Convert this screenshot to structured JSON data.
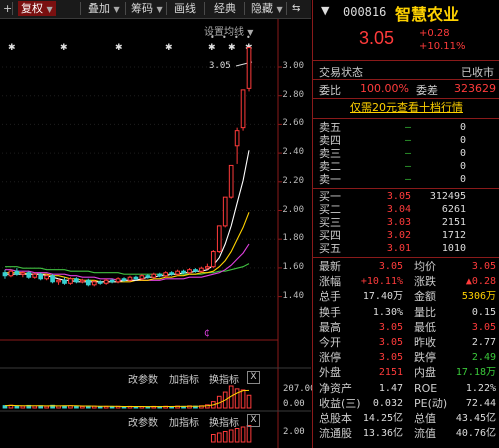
{
  "toolbar": {
    "items": [
      {
        "label": "复权",
        "active": true
      },
      {
        "label": "叠加",
        "active": false
      },
      {
        "label": "筹码",
        "active": false
      },
      {
        "label": "画线",
        "active": false
      },
      {
        "label": "经典",
        "active": false
      },
      {
        "label": "隐藏",
        "active": false
      }
    ]
  },
  "chart": {
    "ma_setting_label": "设置均线",
    "last_price_label": "3.05",
    "price_axis": [
      "3.00",
      "2.80",
      "2.60",
      "2.40",
      "2.20",
      "2.00",
      "1.80",
      "1.60",
      "1.40"
    ],
    "indicator_bar": {
      "params": "改参数",
      "add": "加指标",
      "switch": "换指标",
      "close": "X"
    },
    "volume_axis": {
      "max": "207.00",
      "min": "0.00"
    },
    "bottom_axis": {
      "max": "2.00"
    },
    "colors": {
      "up": "#ff3b3b",
      "down": "#38d0d0",
      "ma5": "#ffffff",
      "ma10": "#ffd200",
      "ma20": "#e040e0",
      "ma60": "#40c040"
    },
    "candles": [
      {
        "o": 1.56,
        "c": 1.54,
        "h": 1.58,
        "l": 1.52,
        "v": 22
      },
      {
        "o": 1.54,
        "c": 1.57,
        "h": 1.58,
        "l": 1.53,
        "v": 26
      },
      {
        "o": 1.57,
        "c": 1.55,
        "h": 1.59,
        "l": 1.54,
        "v": 20
      },
      {
        "o": 1.55,
        "c": 1.56,
        "h": 1.57,
        "l": 1.53,
        "v": 18
      },
      {
        "o": 1.56,
        "c": 1.53,
        "h": 1.57,
        "l": 1.52,
        "v": 24
      },
      {
        "o": 1.53,
        "c": 1.55,
        "h": 1.56,
        "l": 1.52,
        "v": 19
      },
      {
        "o": 1.55,
        "c": 1.52,
        "h": 1.56,
        "l": 1.51,
        "v": 21
      },
      {
        "o": 1.52,
        "c": 1.54,
        "h": 1.55,
        "l": 1.51,
        "v": 17
      },
      {
        "o": 1.54,
        "c": 1.5,
        "h": 1.55,
        "l": 1.49,
        "v": 25
      },
      {
        "o": 1.5,
        "c": 1.51,
        "h": 1.52,
        "l": 1.48,
        "v": 19
      },
      {
        "o": 1.51,
        "c": 1.49,
        "h": 1.53,
        "l": 1.48,
        "v": 20
      },
      {
        "o": 1.49,
        "c": 1.52,
        "h": 1.53,
        "l": 1.48,
        "v": 22
      },
      {
        "o": 1.52,
        "c": 1.5,
        "h": 1.53,
        "l": 1.49,
        "v": 16
      },
      {
        "o": 1.5,
        "c": 1.51,
        "h": 1.52,
        "l": 1.49,
        "v": 15
      },
      {
        "o": 1.51,
        "c": 1.48,
        "h": 1.52,
        "l": 1.47,
        "v": 19
      },
      {
        "o": 1.48,
        "c": 1.5,
        "h": 1.51,
        "l": 1.47,
        "v": 17
      },
      {
        "o": 1.5,
        "c": 1.49,
        "h": 1.51,
        "l": 1.48,
        "v": 14
      },
      {
        "o": 1.49,
        "c": 1.51,
        "h": 1.52,
        "l": 1.48,
        "v": 15
      },
      {
        "o": 1.51,
        "c": 1.5,
        "h": 1.52,
        "l": 1.49,
        "v": 13
      },
      {
        "o": 1.5,
        "c": 1.52,
        "h": 1.53,
        "l": 1.49,
        "v": 16
      },
      {
        "o": 1.52,
        "c": 1.51,
        "h": 1.53,
        "l": 1.5,
        "v": 12
      },
      {
        "o": 1.51,
        "c": 1.53,
        "h": 1.54,
        "l": 1.5,
        "v": 15
      },
      {
        "o": 1.53,
        "c": 1.52,
        "h": 1.54,
        "l": 1.51,
        "v": 13
      },
      {
        "o": 1.52,
        "c": 1.54,
        "h": 1.55,
        "l": 1.51,
        "v": 14
      },
      {
        "o": 1.54,
        "c": 1.53,
        "h": 1.55,
        "l": 1.52,
        "v": 12
      },
      {
        "o": 1.53,
        "c": 1.55,
        "h": 1.56,
        "l": 1.52,
        "v": 15
      },
      {
        "o": 1.55,
        "c": 1.54,
        "h": 1.56,
        "l": 1.53,
        "v": 13
      },
      {
        "o": 1.54,
        "c": 1.56,
        "h": 1.57,
        "l": 1.53,
        "v": 16
      },
      {
        "o": 1.56,
        "c": 1.55,
        "h": 1.57,
        "l": 1.54,
        "v": 14
      },
      {
        "o": 1.55,
        "c": 1.57,
        "h": 1.58,
        "l": 1.54,
        "v": 18
      },
      {
        "o": 1.57,
        "c": 1.56,
        "h": 1.58,
        "l": 1.55,
        "v": 15
      },
      {
        "o": 1.56,
        "c": 1.58,
        "h": 1.59,
        "l": 1.55,
        "v": 20
      },
      {
        "o": 1.58,
        "c": 1.57,
        "h": 1.59,
        "l": 1.56,
        "v": 17
      },
      {
        "o": 1.57,
        "c": 1.59,
        "h": 1.6,
        "l": 1.56,
        "v": 21
      },
      {
        "o": 1.59,
        "c": 1.6,
        "h": 1.62,
        "l": 1.58,
        "v": 30
      },
      {
        "o": 1.6,
        "c": 1.7,
        "h": 1.71,
        "l": 1.59,
        "v": 60
      },
      {
        "o": 1.7,
        "c": 1.87,
        "h": 1.87,
        "l": 1.69,
        "v": 110
      },
      {
        "o": 1.87,
        "c": 2.06,
        "h": 2.06,
        "l": 1.86,
        "v": 150
      },
      {
        "o": 2.06,
        "c": 2.27,
        "h": 2.27,
        "l": 2.05,
        "v": 207
      },
      {
        "o": 2.4,
        "c": 2.5,
        "h": 2.52,
        "l": 2.28,
        "v": 180
      },
      {
        "o": 2.52,
        "c": 2.77,
        "h": 2.77,
        "l": 2.5,
        "v": 170
      },
      {
        "o": 2.78,
        "c": 3.05,
        "h": 3.05,
        "l": 2.76,
        "v": 120
      }
    ],
    "ma": {
      "ma5": [
        1.55,
        1.55,
        1.55,
        1.55,
        1.55,
        1.55,
        1.55,
        1.54,
        1.53,
        1.52,
        1.51,
        1.51,
        1.5,
        1.5,
        1.5,
        1.5,
        1.5,
        1.5,
        1.5,
        1.5,
        1.51,
        1.51,
        1.51,
        1.52,
        1.53,
        1.53,
        1.54,
        1.54,
        1.55,
        1.55,
        1.56,
        1.56,
        1.57,
        1.57,
        1.58,
        1.61,
        1.66,
        1.75,
        1.87,
        2.02,
        2.17,
        2.37
      ],
      "ma10": [
        1.56,
        1.56,
        1.56,
        1.56,
        1.55,
        1.55,
        1.55,
        1.55,
        1.54,
        1.54,
        1.53,
        1.52,
        1.52,
        1.51,
        1.51,
        1.51,
        1.5,
        1.5,
        1.5,
        1.5,
        1.5,
        1.5,
        1.51,
        1.51,
        1.51,
        1.52,
        1.52,
        1.53,
        1.53,
        1.54,
        1.54,
        1.55,
        1.55,
        1.56,
        1.56,
        1.57,
        1.6,
        1.64,
        1.7,
        1.78,
        1.86,
        1.96
      ],
      "ma20": [
        1.58,
        1.58,
        1.57,
        1.57,
        1.57,
        1.56,
        1.56,
        1.56,
        1.55,
        1.55,
        1.55,
        1.54,
        1.54,
        1.53,
        1.53,
        1.53,
        1.52,
        1.52,
        1.52,
        1.51,
        1.51,
        1.51,
        1.51,
        1.51,
        1.51,
        1.51,
        1.51,
        1.52,
        1.52,
        1.52,
        1.52,
        1.53,
        1.53,
        1.53,
        1.54,
        1.55,
        1.56,
        1.58,
        1.61,
        1.65,
        1.69,
        1.75
      ],
      "ma60": [
        1.6,
        1.6,
        1.6,
        1.59,
        1.59,
        1.59,
        1.59,
        1.58,
        1.58,
        1.58,
        1.58,
        1.57,
        1.57,
        1.57,
        1.57,
        1.56,
        1.56,
        1.56,
        1.56,
        1.56,
        1.55,
        1.55,
        1.55,
        1.55,
        1.55,
        1.55,
        1.55,
        1.55,
        1.55,
        1.55,
        1.55,
        1.55,
        1.55,
        1.55,
        1.56,
        1.56,
        1.57,
        1.57,
        1.58,
        1.59,
        1.6,
        1.62
      ]
    },
    "y_range": [
      1.3,
      3.1
    ]
  },
  "quote": {
    "code": "000816",
    "name": "智慧农业",
    "price": "3.05",
    "change": "+0.28",
    "pct": "+10.11%",
    "status_label": "交易状态",
    "status_value": "已收市",
    "ratio_label": "委比",
    "ratio_value": "100.00%",
    "diff_label": "委差",
    "diff_value": "323629",
    "promo": "仅需20元查看十档行情"
  },
  "orderbook": {
    "asks": [
      {
        "label": "卖五",
        "price": "—",
        "vol": "0"
      },
      {
        "label": "卖四",
        "price": "—",
        "vol": "0"
      },
      {
        "label": "卖三",
        "price": "—",
        "vol": "0"
      },
      {
        "label": "卖二",
        "price": "—",
        "vol": "0"
      },
      {
        "label": "卖一",
        "price": "—",
        "vol": "0"
      }
    ],
    "bids": [
      {
        "label": "买一",
        "price": "3.05",
        "vol": "312495"
      },
      {
        "label": "买二",
        "price": "3.04",
        "vol": "6261"
      },
      {
        "label": "买三",
        "price": "3.03",
        "vol": "2151"
      },
      {
        "label": "买四",
        "price": "3.02",
        "vol": "1712"
      },
      {
        "label": "买五",
        "price": "3.01",
        "vol": "1010"
      }
    ]
  },
  "stats": [
    {
      "l": "最新",
      "lv": "3.05",
      "lc": "red",
      "r": "均价",
      "rv": "3.05",
      "rc": "red"
    },
    {
      "l": "涨幅",
      "lv": "+10.11%",
      "lc": "red",
      "r": "涨跌",
      "rv": "▲0.28",
      "rc": "red"
    },
    {
      "l": "总手",
      "lv": "17.40万",
      "lc": "white",
      "r": "金额",
      "rv": "5306万",
      "rc": "badge"
    },
    {
      "l": "换手",
      "lv": "1.30%",
      "lc": "white",
      "r": "量比",
      "rv": "0.15",
      "rc": "white"
    },
    {
      "l": "最高",
      "lv": "3.05",
      "lc": "red",
      "r": "最低",
      "rv": "3.05",
      "rc": "red"
    },
    {
      "l": "今开",
      "lv": "3.05",
      "lc": "red",
      "r": "昨收",
      "rv": "2.77",
      "rc": "white"
    },
    {
      "l": "涨停",
      "lv": "3.05",
      "lc": "red",
      "r": "跌停",
      "rv": "2.49",
      "rc": "green"
    },
    {
      "l": "外盘",
      "lv": "2151",
      "lc": "red",
      "r": "内盘",
      "rv": "17.18万",
      "rc": "green"
    },
    {
      "l": "净资产",
      "lv": "1.47",
      "lc": "white",
      "r": "ROE",
      "rv": "1.22%",
      "rc": "white"
    },
    {
      "l": "收益(三)",
      "lv": "0.032",
      "lc": "white",
      "r": "PE(动)",
      "rv": "72.44",
      "rc": "white"
    },
    {
      "l": "总股本",
      "lv": "14.25亿",
      "lc": "white",
      "r": "总值",
      "rv": "43.45亿",
      "rc": "white"
    },
    {
      "l": "流通股",
      "lv": "13.36亿",
      "lc": "white",
      "r": "流值",
      "rv": "40.76亿",
      "rc": "white"
    }
  ]
}
